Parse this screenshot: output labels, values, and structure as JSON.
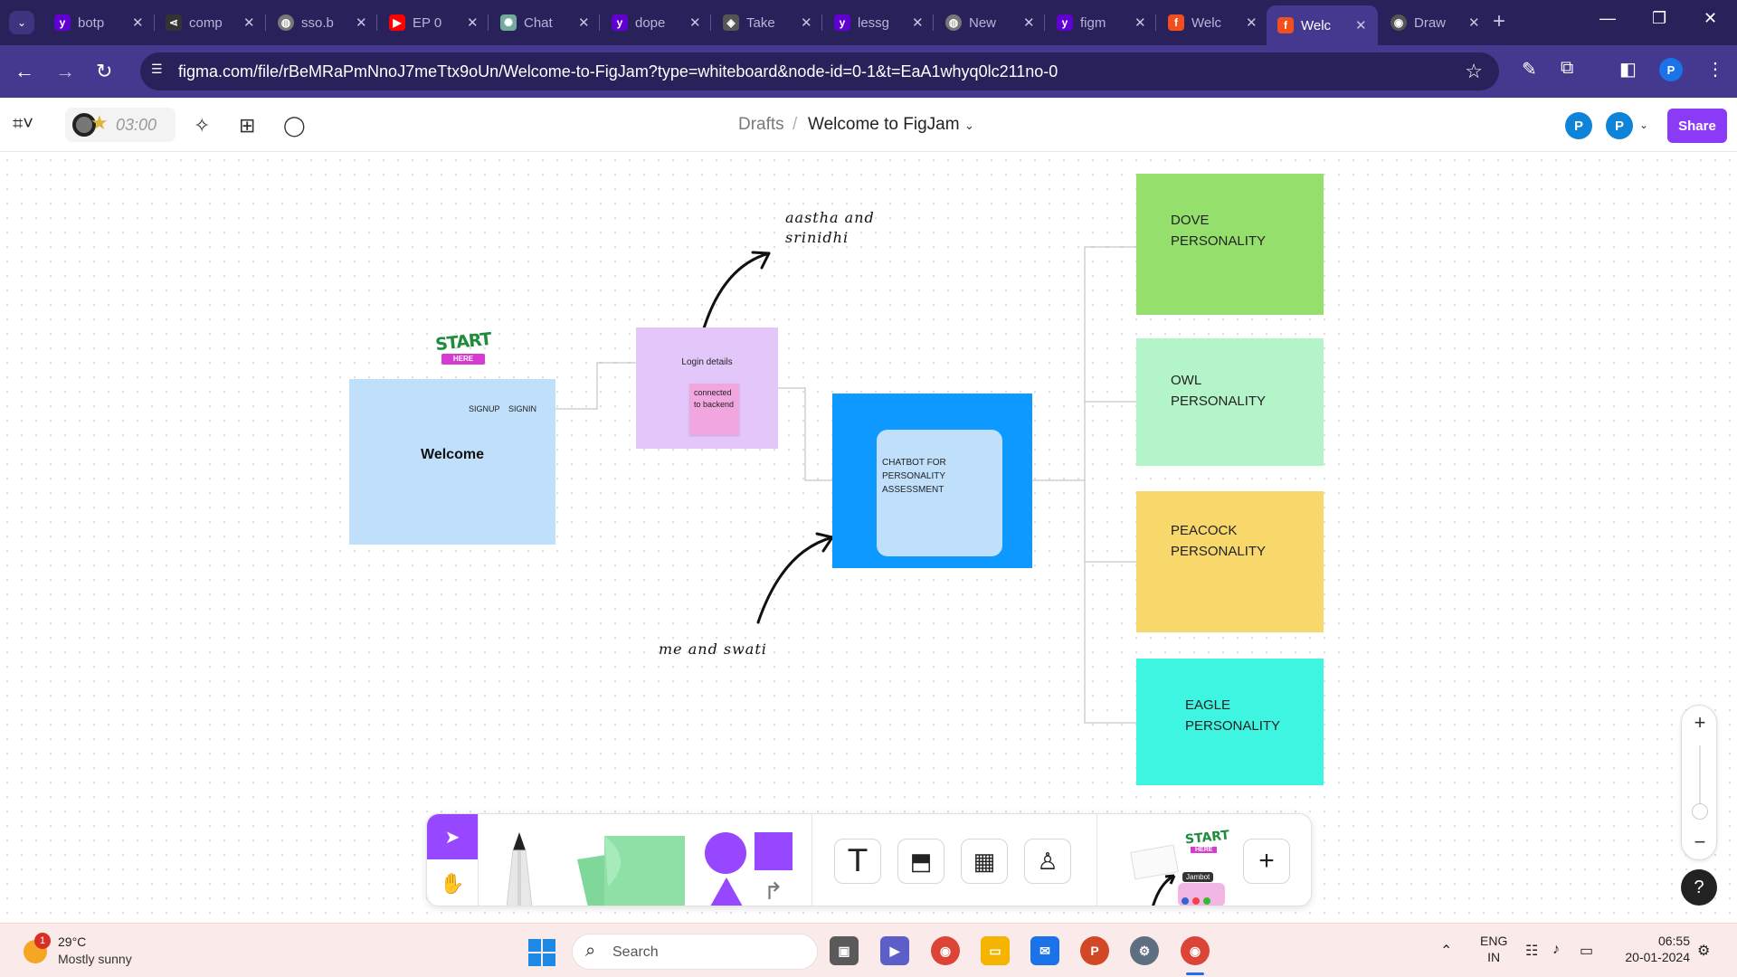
{
  "browser": {
    "tabs": [
      {
        "label": "botp",
        "favicon": "yahoo-icon",
        "color": "#6001d2"
      },
      {
        "label": "comp",
        "favicon": "share-icon",
        "color": "#555555"
      },
      {
        "label": "sso.b",
        "favicon": "globe-icon",
        "color": "#777777"
      },
      {
        "label": "EP 0",
        "favicon": "youtube-icon",
        "color": "#ff0000"
      },
      {
        "label": "Chat",
        "favicon": "chatgpt-icon",
        "color": "#74aa9c"
      },
      {
        "label": "dope",
        "favicon": "yahoo-icon",
        "color": "#6001d2"
      },
      {
        "label": "Take",
        "favicon": "shield-icon",
        "color": "#555555"
      },
      {
        "label": "lessg",
        "favicon": "yahoo-icon",
        "color": "#6001d2"
      },
      {
        "label": "New",
        "favicon": "globe-icon",
        "color": "#777777"
      },
      {
        "label": "figm",
        "favicon": "yahoo-icon",
        "color": "#6001d2"
      },
      {
        "label": "Welc",
        "favicon": "figma-icon",
        "color": "#f24e1e"
      },
      {
        "label": "Welc",
        "favicon": "figma-icon",
        "color": "#f24e1e",
        "active": true
      },
      {
        "label": "Draw",
        "favicon": "draw-icon",
        "color": "#555555"
      }
    ],
    "url": "figma.com/file/rBeMRaPmNnoJ7meTtx9oUn/Welcome-to-FigJam?type=whiteboard&node-id=0-1&t=EaA1whyq0lc211no-0",
    "profile_initial": "P"
  },
  "figjam": {
    "timer": "03:00",
    "breadcrumb": {
      "parent": "Drafts",
      "separator": "/",
      "file": "Welcome to FigJam"
    },
    "avatars": [
      "P",
      "P"
    ],
    "share_label": "Share",
    "accent": "#9747ff"
  },
  "canvas": {
    "sticker": {
      "title": "START",
      "ribbon": "HERE"
    },
    "welcome_frame": {
      "links": [
        "SIGNUP",
        "SIGNIN"
      ],
      "title": "Welcome",
      "color": "#bfdffb"
    },
    "login_frame": {
      "title": "Login details",
      "note": "connected to backend",
      "color": "#e3c7fa"
    },
    "chatbot": {
      "lines": [
        "CHATBOT FOR",
        "PERSONALITY",
        "ASSESSMENT"
      ],
      "color": "#0d99ff"
    },
    "annotations": {
      "top": [
        "aastha and",
        "srinidhi"
      ],
      "bottom": "me and swati"
    },
    "personalities": [
      {
        "lines": [
          "DOVE",
          "PERSONALITY"
        ],
        "color": "#95e06c"
      },
      {
        "lines": [
          "OWL",
          "PERSONALITY"
        ],
        "color": "#b3f4c8"
      },
      {
        "lines": [
          "PEACOCK",
          "PERSONALITY"
        ],
        "color": "#f8d86b"
      },
      {
        "lines": [
          "EAGLE",
          "PERSONALITY"
        ],
        "color": "#3ef5e2"
      }
    ]
  },
  "toolbar": {
    "sticker_mini": {
      "title": "START",
      "ribbon": "HERE",
      "caption": "Jambot"
    }
  },
  "taskbar": {
    "weather": {
      "temp": "29°C",
      "desc": "Mostly sunny",
      "badge": "1"
    },
    "search_placeholder": "Search",
    "language": [
      "ENG",
      "IN"
    ],
    "time": "06:55",
    "date": "20-01-2024"
  }
}
